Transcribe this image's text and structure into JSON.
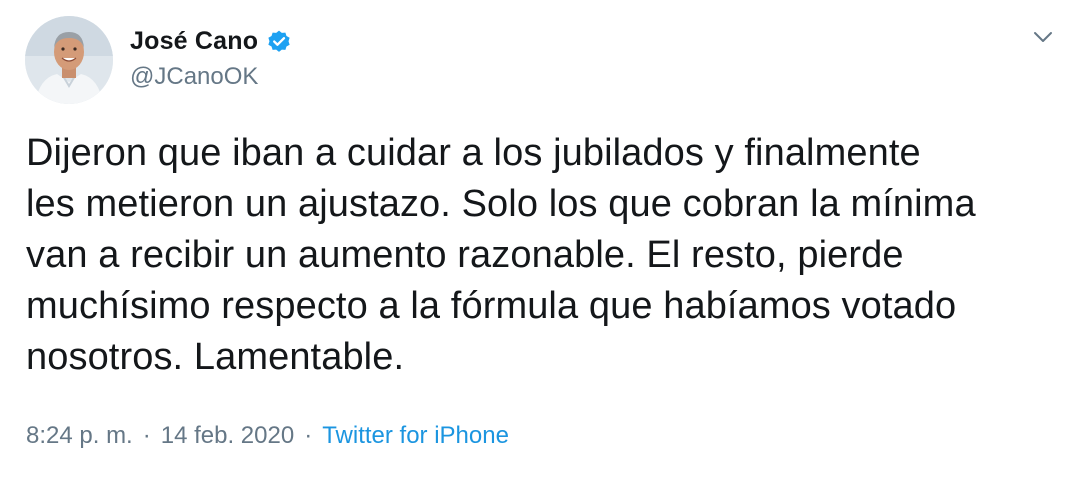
{
  "tweet": {
    "author": {
      "display_name": "José Cano",
      "handle": "@JCanoOK",
      "verified": true,
      "verified_color": "#1da1f2"
    },
    "text_lines": [
      "Dijeron que iban a cuidar a los jubilados y finalmente",
      "les metieron un ajustazo. Solo los que cobran la mínima",
      "van a recibir un aumento razonable. El resto, pierde",
      "muchísimo respecto a la fórmula que habíamos votado",
      "nosotros. Lamentable."
    ],
    "meta": {
      "time": "8:24 p. m.",
      "separator_1": "·",
      "date": "14 feb. 2020",
      "separator_2": "·",
      "source": "Twitter for iPhone"
    },
    "icons": {
      "verified": "verified-badge-icon",
      "menu": "chevron-down-icon"
    },
    "colors": {
      "text": "#14171a",
      "secondary": "#657786",
      "link": "#1b95e0"
    }
  }
}
